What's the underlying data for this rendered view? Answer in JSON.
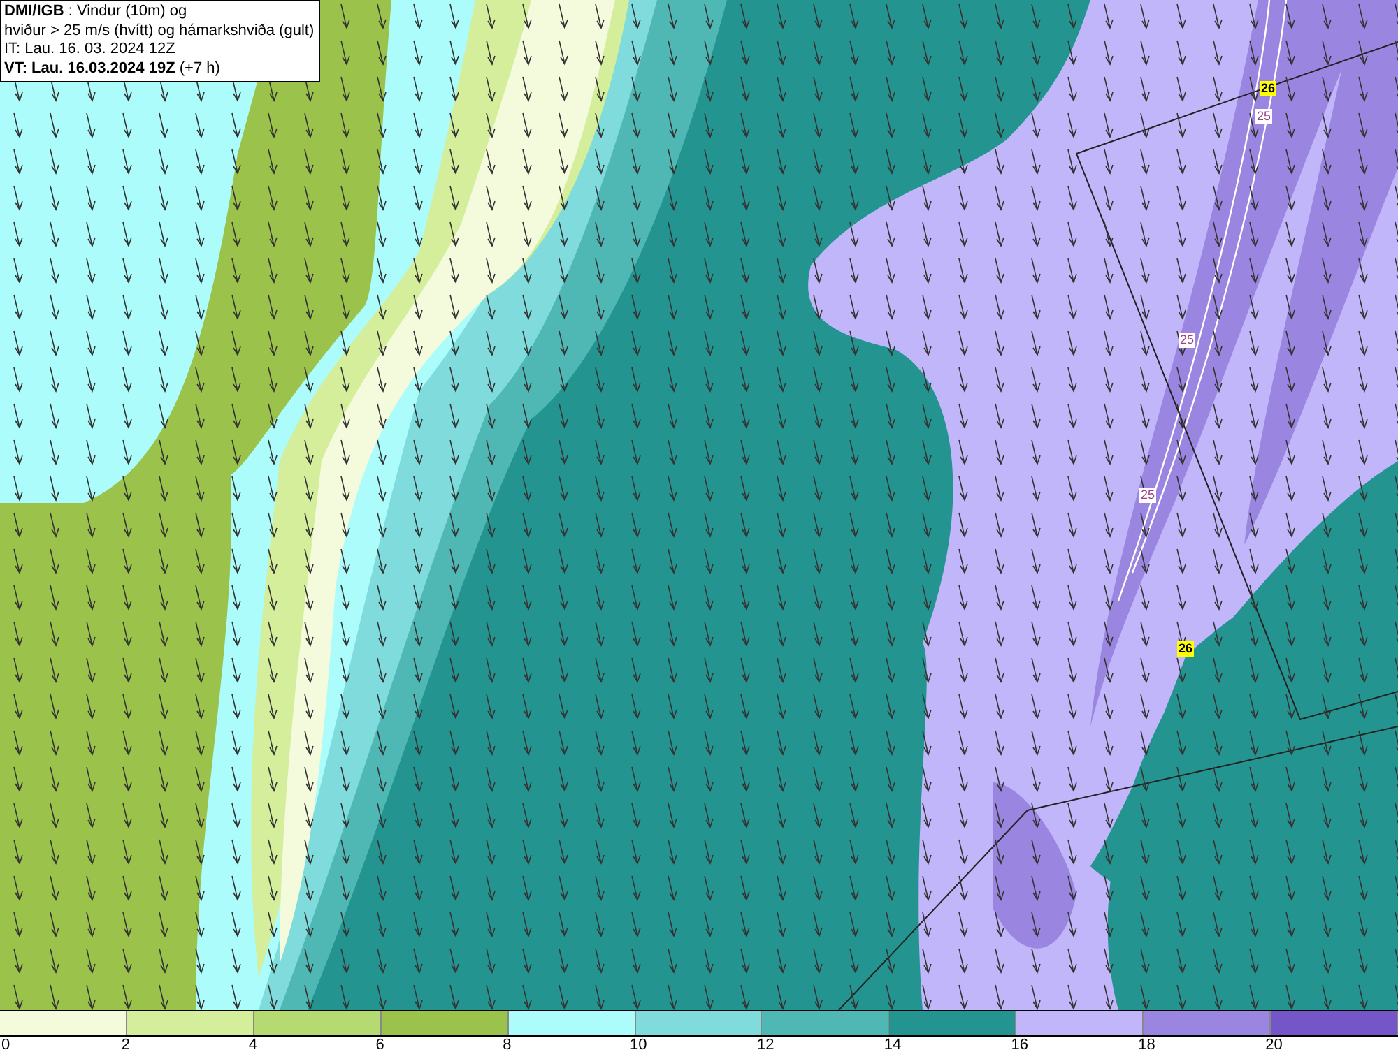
{
  "title_box": {
    "lines": [
      "**DMI/IGB** : Vindur (10m) og",
      "hviður > 25 m/s (hvítt) og hámarkshviða (gult)",
      "IT: Lau. 16. 03. 2024 12Z",
      "**VT: Lau. 16.03.2024 19Z** (+7 h)"
    ]
  },
  "map": {
    "labels": [
      {
        "text": "26",
        "kind": "max"
      },
      {
        "text": "25",
        "kind": "gust"
      },
      {
        "text": "25",
        "kind": "gust"
      },
      {
        "text": "25",
        "kind": "gust"
      },
      {
        "text": "26",
        "kind": "max"
      }
    ]
  },
  "legend": {
    "bins": [
      {
        "label": "0",
        "color": "#f4fadc"
      },
      {
        "label": "2",
        "color": "#d4ee9c"
      },
      {
        "label": "4",
        "color": "#b6da72"
      },
      {
        "label": "6",
        "color": "#9bc24a"
      },
      {
        "label": "8",
        "color": "#acfcfc"
      },
      {
        "label": "10",
        "color": "#80dcdc"
      },
      {
        "label": "12",
        "color": "#50b8b4"
      },
      {
        "label": "14",
        "color": "#239490"
      },
      {
        "label": "16",
        "color": "#c2b6fa"
      },
      {
        "label": "18",
        "color": "#9a86e0"
      },
      {
        "label": "20",
        "color": "#7456c8"
      }
    ]
  }
}
